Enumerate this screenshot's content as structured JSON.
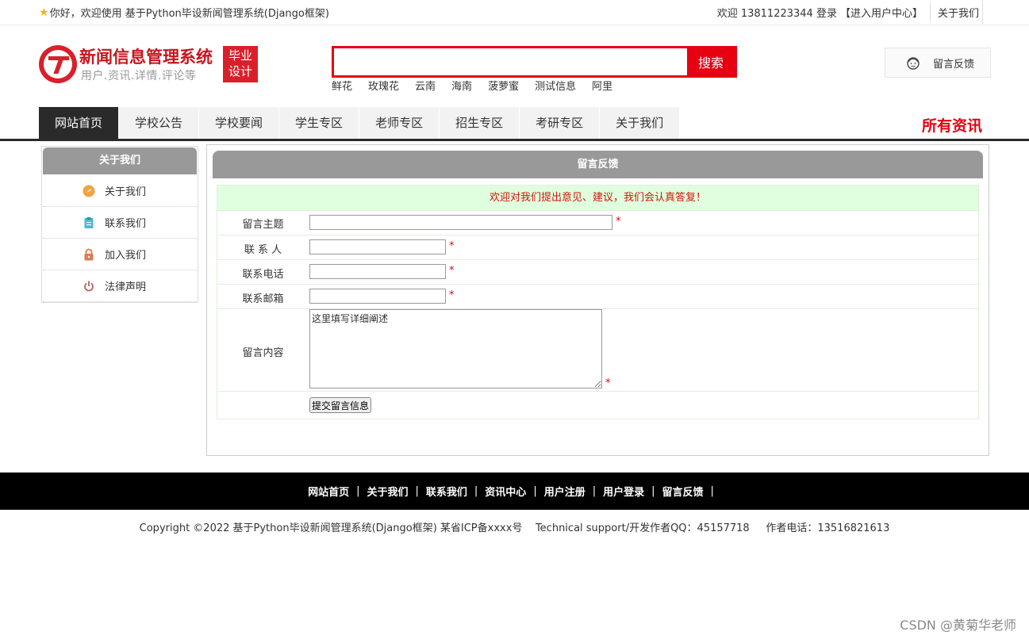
{
  "topbar": {
    "welcome": "你好，欢迎使用 基于Python毕设新闻管理系统(Django框架)",
    "user_info": "欢迎 13811223344 登录",
    "user_center": "【进入用户中心】",
    "about": "关于我们"
  },
  "header": {
    "title": "新闻信息管理系统",
    "subtitle": "用户.资讯.详情.评论等",
    "badge_line1": "毕业",
    "badge_line2": "设计",
    "search_button": "搜索",
    "search_value": "",
    "hot_words": [
      "鲜花",
      "玫瑰花",
      "云南",
      "海南",
      "菠萝蜜",
      "测试信息",
      "阿里"
    ],
    "feedback": "留言反馈"
  },
  "nav": {
    "items": [
      "网站首页",
      "学校公告",
      "学校要闻",
      "学生专区",
      "老师专区",
      "招生专区",
      "考研专区",
      "关于我们"
    ],
    "all_news": "所有资讯"
  },
  "sidebar": {
    "title": "关于我们",
    "items": [
      {
        "label": "关于我们",
        "icon": "orange-circle-icon"
      },
      {
        "label": "联系我们",
        "icon": "clipboard-icon"
      },
      {
        "label": "加入我们",
        "icon": "lock-icon"
      },
      {
        "label": "法律声明",
        "icon": "power-icon"
      }
    ]
  },
  "main": {
    "title": "留言反馈",
    "notice": "欢迎对我们提出意见、建议，我们会认真答复！",
    "fields": {
      "subject_label": "留言主题",
      "contact_label": "联 系 人",
      "phone_label": "联系电话",
      "email_label": "联系邮箱",
      "content_label": "留言内容",
      "content_value": "这里填写详细阐述",
      "required_mark": "*"
    },
    "submit": "提交留言信息"
  },
  "footer": {
    "links": [
      "网站首页",
      "关于我们",
      "联系我们",
      "资讯中心",
      "用户注册",
      "用户登录",
      "留言反馈"
    ],
    "separator": "|",
    "copyright": "Copyright ©2022 基于Python毕设新闻管理系统(Django框架) 某省ICP备xxxx号    Technical support/开发作者QQ：45157718     作者电话：13516821613"
  },
  "watermark": "CSDN @黄菊华老师",
  "colors": {
    "brand_red": "#e60012",
    "nav_dark": "#2a2a2a",
    "panel_gray": "#999999",
    "notice_bg": "#dfffdf"
  }
}
